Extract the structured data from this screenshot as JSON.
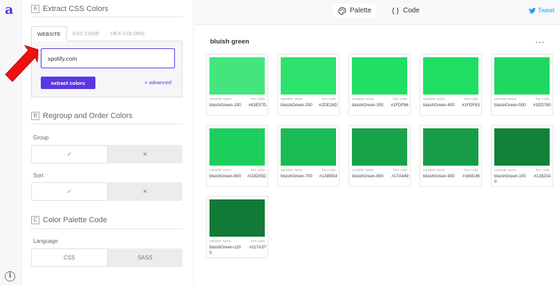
{
  "rail": {
    "logo": "a",
    "info": "i"
  },
  "sections": {
    "extract": {
      "letter": "A",
      "title": "Extract CSS Colors"
    },
    "regroup": {
      "letter": "B",
      "title": "Regroup and Order Colors"
    },
    "code": {
      "letter": "C",
      "title": "Color Palette Code"
    }
  },
  "tabs": [
    "WEBSITE",
    "CSS CODE",
    "HEX COLORS"
  ],
  "url_input": {
    "value": "spotify.com"
  },
  "extract_button": "extract colors",
  "advanced_link": "+ advanced",
  "group": {
    "label": "Group",
    "options": [
      "✓",
      "✕"
    ]
  },
  "sort": {
    "label": "Sort",
    "options": [
      "✓",
      "✕"
    ]
  },
  "language": {
    "label": "Language",
    "options": [
      "CSS",
      "SASS"
    ]
  },
  "topbar": {
    "palette": "Palette",
    "code": "Code",
    "tweet": "Tweet"
  },
  "palette": {
    "title": "bluish green",
    "more": "...",
    "var_header": "variable name",
    "hex_header": "hex code",
    "colors": [
      {
        "name": "bluishGreen-100",
        "hex": "#43E57D"
      },
      {
        "name": "bluishGreen-200",
        "hex": "#2DE26D"
      },
      {
        "name": "bluishGreen-300",
        "hex": "#1FDF64"
      },
      {
        "name": "bluishGreen-400",
        "hex": "#1FDF63"
      },
      {
        "name": "bluishGreen-500",
        "hex": "#1ED760"
      },
      {
        "name": "bluishGreen-600",
        "hex": "#1DD05D"
      },
      {
        "name": "bluishGreen-700",
        "hex": "#1ABB54"
      },
      {
        "name": "bluishGreen-800",
        "hex": "#17A449"
      },
      {
        "name": "bluishGreen-900",
        "hex": "#169C46"
      },
      {
        "name": "bluishGreen-1000",
        "hex": "#12823A"
      },
      {
        "name": "bluishGreen-1100",
        "hex": "#117A37"
      }
    ]
  },
  "accent": "#5b36e6"
}
